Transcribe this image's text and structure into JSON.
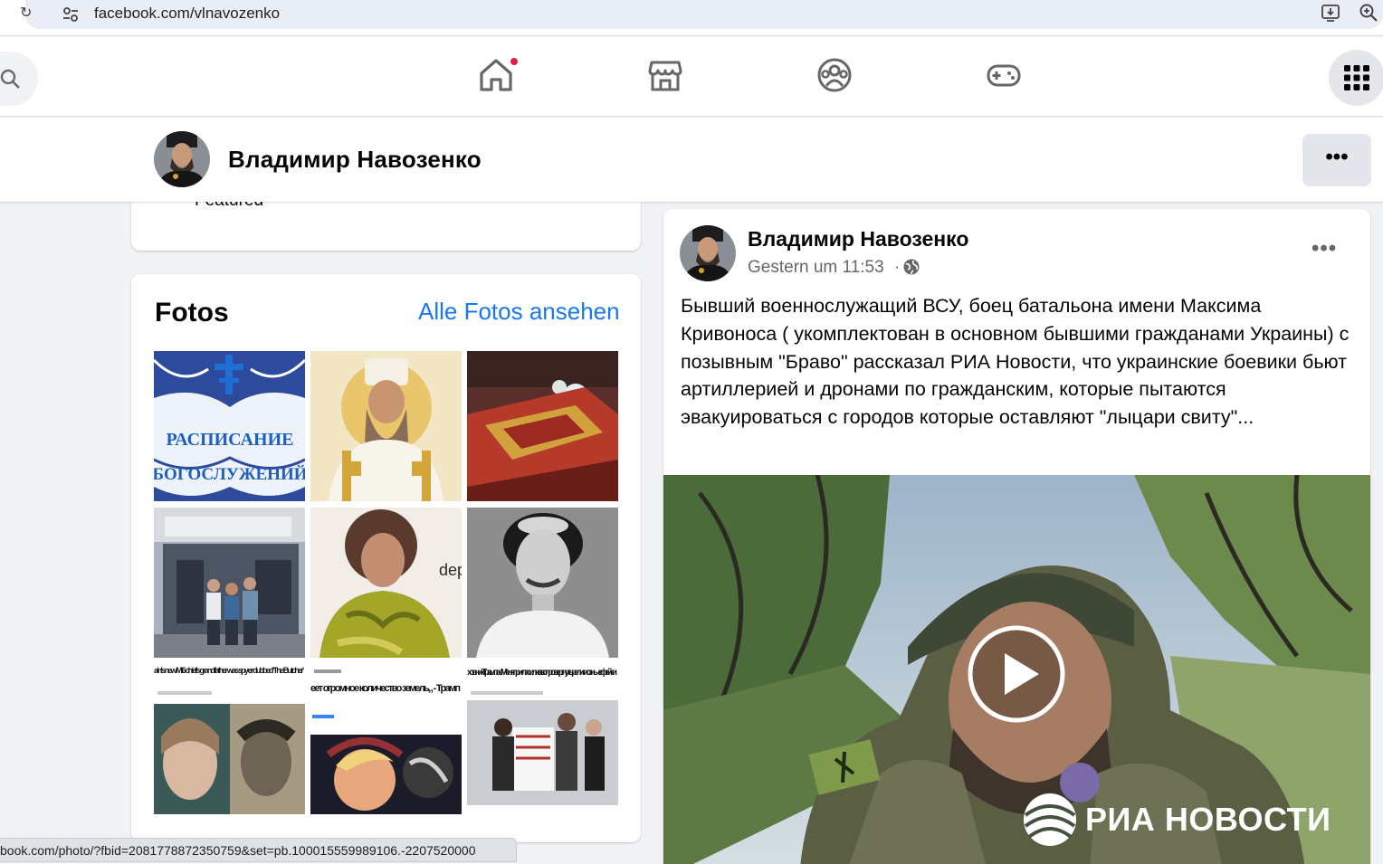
{
  "browser": {
    "url": "facebook.com/vlnavozenko",
    "status_link": "book.com/photo/?fbid=2081778872350759&set=pb.100015559989106.-2207520000"
  },
  "nav": {
    "icons": [
      "search-icon",
      "home-icon",
      "marketplace-icon",
      "groups-icon",
      "gaming-icon",
      "menu-grid-icon"
    ],
    "notification_color": "#e41e3f"
  },
  "profile": {
    "name": "Владимир Навозенко"
  },
  "featured": {
    "label": "Featured"
  },
  "photos": {
    "title": "Fotos",
    "see_all": "Alle Fotos ansehen",
    "captions": {
      "schedule_line1": "РАСПИСАНИЕ",
      "schedule_line2": "БОГОСЛУЖЕНИЙ",
      "depo": "depo",
      "news1_headline": "ain's new MI6 chief's grandfather was spy er dubbed 'The Butcher'",
      "news2_headline": "еет огромное количество земель, , - Трамп",
      "news3_headline": "ховник Трампа»: Меня пригласили в в опровергнуть религиозные фейки"
    }
  },
  "post": {
    "author": "Владимир Навозенко",
    "time": "Gestern um 11:53",
    "separator": "·",
    "text": "Бывший военнослужащий ВСУ, боец батальона имени Максима Кривоноса ( укомплектован в основном бывшими гражданами Украины) с позывным \"Браво\" рассказал РИА Новости, что украинские боевики бьют артиллерией и дронами по гражданским, которые пытаются эвакуироваться с городов которые оставляют \"лыцари свиту\"...",
    "more_label": "•••",
    "video_watermark": "РИА НОВОСТИ"
  },
  "colors": {
    "accent": "#1877f2",
    "background": "#f0f2f5"
  }
}
